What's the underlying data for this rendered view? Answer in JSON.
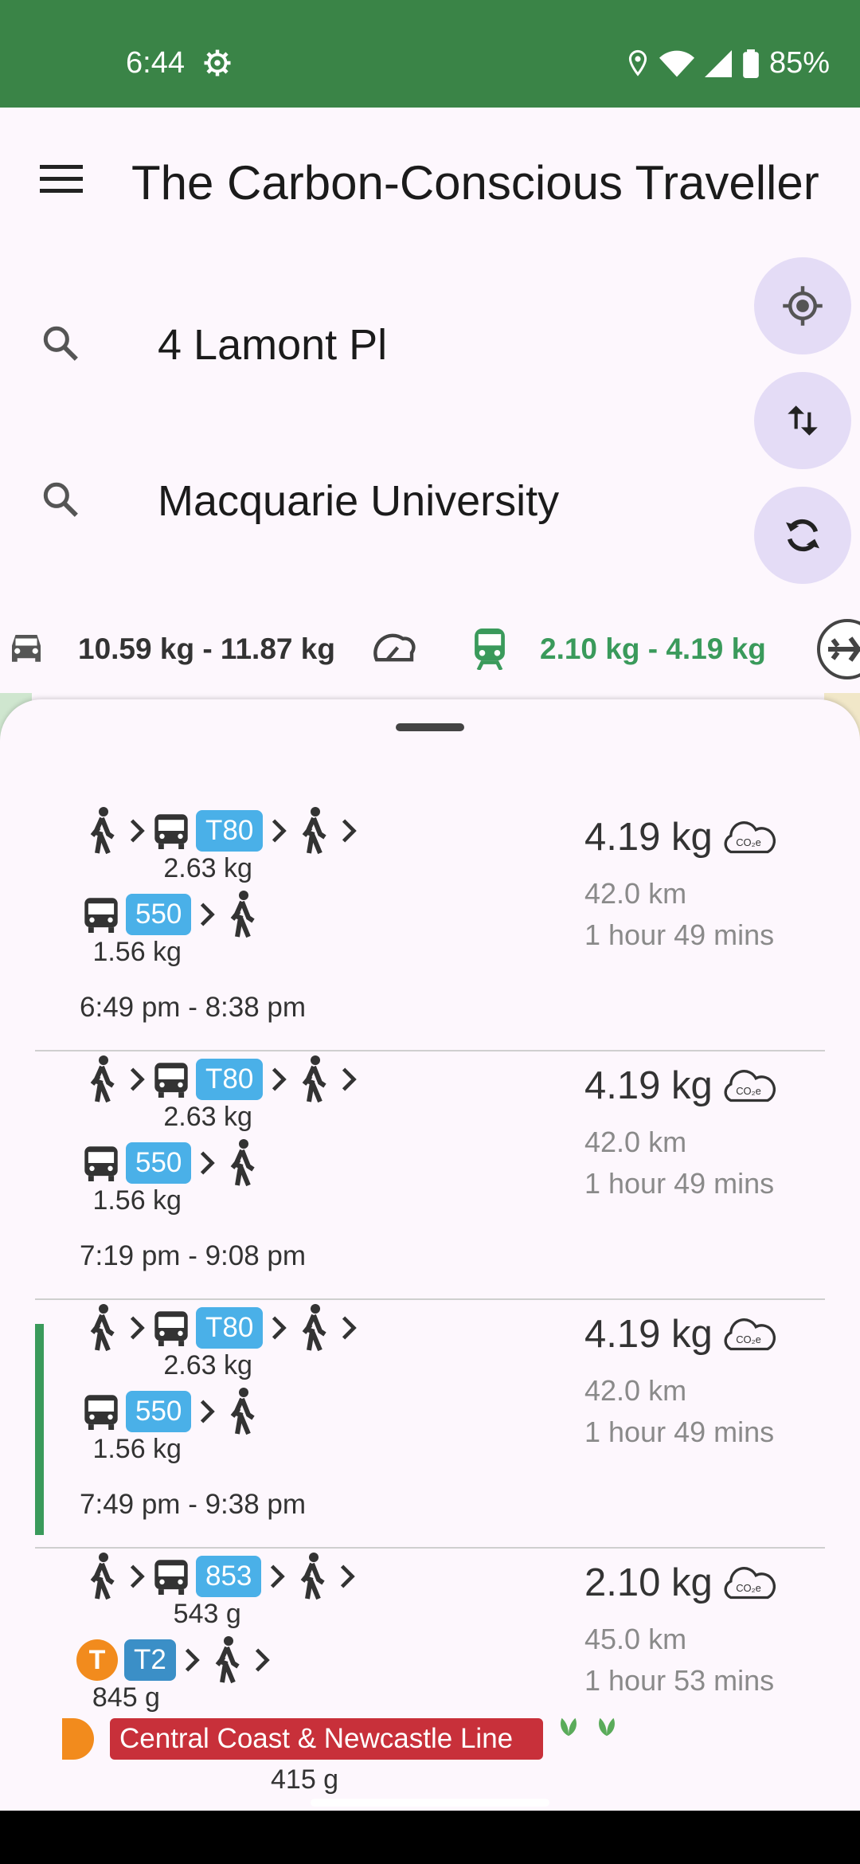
{
  "status": {
    "time": "6:44",
    "battery": "85%"
  },
  "app": {
    "title": "The Carbon-Conscious Traveller"
  },
  "search": {
    "origin": "4 Lamont Pl",
    "destination": "Macquarie University"
  },
  "modes": {
    "car": "10.59 kg - 11.87 kg",
    "transit": "2.10 kg - 4.19 kg"
  },
  "routes": [
    {
      "leg1_badge": "T80",
      "leg1_weight": "2.63 kg",
      "leg2_badge": "550",
      "leg2_weight": "1.56 kg",
      "times": "6:49 pm - 8:38 pm",
      "emission": "4.19 kg",
      "distance": "42.0 km",
      "duration": "1 hour 49 mins"
    },
    {
      "leg1_badge": "T80",
      "leg1_weight": "2.63 kg",
      "leg2_badge": "550",
      "leg2_weight": "1.56 kg",
      "times": "7:19 pm - 9:08 pm",
      "emission": "4.19 kg",
      "distance": "42.0 km",
      "duration": "1 hour 49 mins"
    },
    {
      "leg1_badge": "T80",
      "leg1_weight": "2.63 kg",
      "leg2_badge": "550",
      "leg2_weight": "1.56 kg",
      "times": "7:49 pm - 9:38 pm",
      "emission": "4.19 kg",
      "distance": "42.0 km",
      "duration": "1 hour 49 mins"
    },
    {
      "leg1_badge": "853",
      "leg1_weight": "543 g",
      "train_icon": "T",
      "leg2_badge": "T2",
      "leg2_weight": "845 g",
      "line_name": "Central Coast & Newcastle Line",
      "line_weight": "415 g",
      "emission": "2.10 kg",
      "distance": "45.0 km",
      "duration": "1 hour 53 mins"
    }
  ],
  "colors": {
    "status_bar": "#3a8447",
    "accent_green": "#3a9a5b",
    "badge_blue": "#4ab0e8",
    "fab": "#e4dcf6"
  },
  "icons": {
    "menu": "menu-icon",
    "search": "search-icon",
    "my_location": "my-location-icon",
    "swap": "swap-vert-icon",
    "refresh": "refresh-icon",
    "car": "car-icon",
    "motorbike": "motorbike-icon",
    "train": "train-icon",
    "plane": "plane-icon",
    "walk": "walk-icon",
    "bus": "bus-icon",
    "co2_cloud": "co2-cloud-icon",
    "leaf": "leaf-icon"
  }
}
